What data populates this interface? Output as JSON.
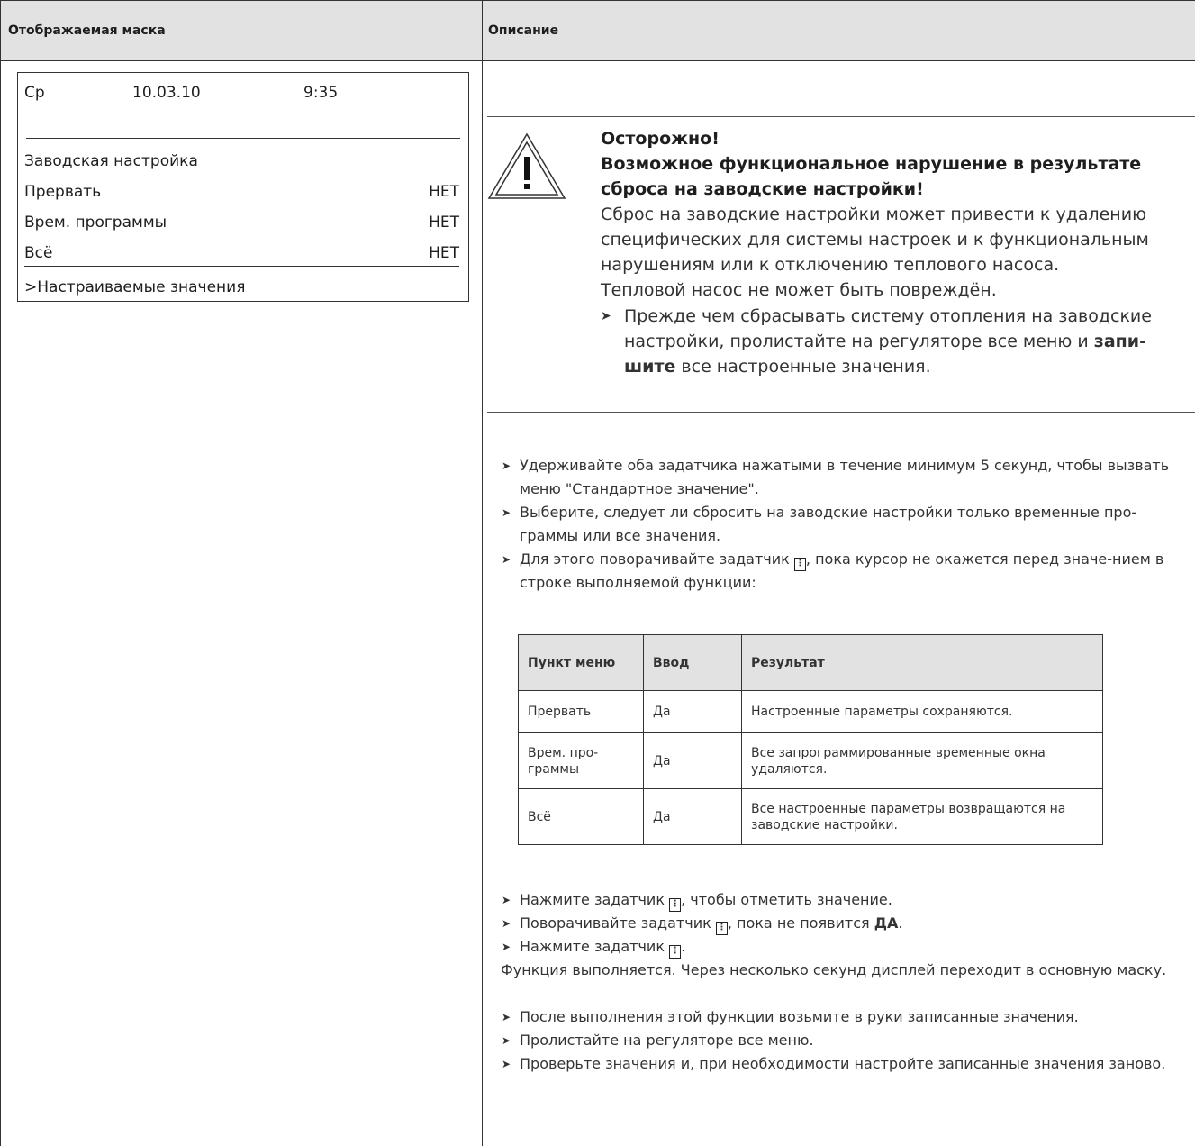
{
  "header": {
    "left": "Отображаемая маска",
    "right": "Описание"
  },
  "mask": {
    "day": "Ср",
    "date": "10.03.10",
    "time": "9:35",
    "title": "Заводская настройка",
    "rows": [
      {
        "label": "Прервать",
        "value": "НЕТ"
      },
      {
        "label": "Врем. программы",
        "value": "НЕТ"
      },
      {
        "label": "Всё",
        "value": "НЕТ"
      }
    ],
    "footer": ">Настраиваемые значения"
  },
  "warning": {
    "icon": "warning-triangle-icon",
    "title1": "Осторожно!",
    "title2": "Возможное функциональное нарушение в результате сброса на заводские настройки!",
    "body": "Сброс на заводские настройки может привести к удалению специфических для системы настроек и к функциональным нарушениям или к отключению теплового насоса.",
    "body2": "Тепловой насос не может быть повреждён.",
    "action_pre": "Прежде чем сбрасывать систему отопления на заводские настройки, пролистайте на регуляторе все меню и ",
    "action_bold": "запи-шите",
    "action_post": " все настроенные значения."
  },
  "steps1": [
    "Удерживайте оба задатчика нажатыми в течение минимум 5 секунд, чтобы вызвать меню \"Стандартное значение\".",
    "Выберите, следует ли сбросить на заводские настройки только временные про-граммы или все значения."
  ],
  "step3": {
    "pre": "Для этого поворачивайте задатчик",
    "post": ", пока курсор не окажется перед значе-нием в строке выполняемой функции:"
  },
  "table": {
    "headers": [
      "Пункт меню",
      "Ввод",
      "Результат"
    ],
    "rows": [
      [
        "Прервать",
        "Да",
        "Настроенные параметры сохраняются."
      ],
      [
        "Врем. про-граммы",
        "Да",
        "Все запрограммированные временные окна удаляются."
      ],
      [
        "Всё",
        "Да",
        "Все настроенные параметры возвращаются на заводские настройки."
      ]
    ]
  },
  "steps2": {
    "s1_pre": "Нажмите задатчик",
    "s1_post": ", чтобы отметить значение.",
    "s2_pre": "Поворачивайте задатчик",
    "s2_mid": ", пока не появится ",
    "s2_bold": "ДА",
    "s2_post": ".",
    "s3_pre": "Нажмите задатчик",
    "s3_post": "."
  },
  "result_text": "Функция выполняется. Через несколько секунд дисплей переходит в основную маску.",
  "steps3": [
    "После выполнения этой функции возьмите в руки записанные значения.",
    "Пролистайте на регуляторе все меню.",
    "Проверьте значения и, при необходимости настройте записанные значения заново."
  ]
}
